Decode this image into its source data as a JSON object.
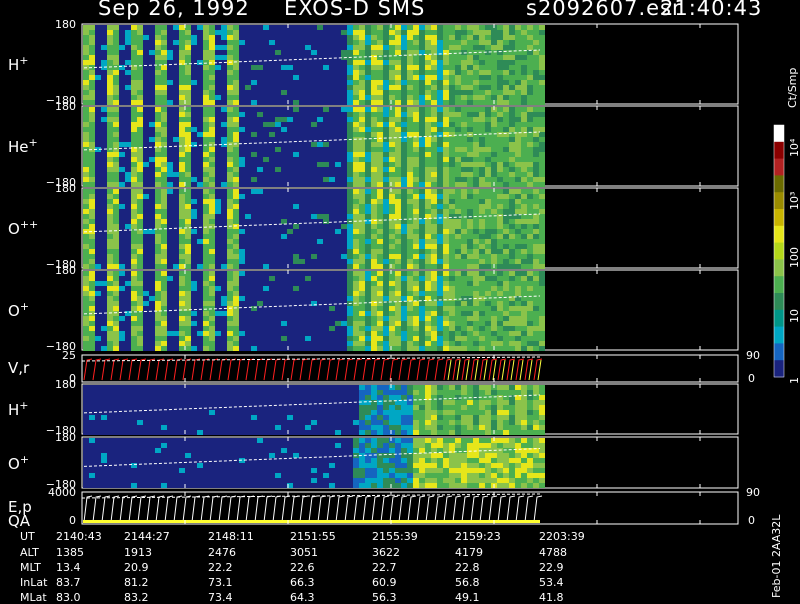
{
  "header": {
    "date": "Sep 26, 1992",
    "instrument": "EXOS-D SMS",
    "file": "s2092607.esr",
    "time": "21:40:43"
  },
  "panels": [
    {
      "label": "H",
      "sup": "+",
      "ymax": "180",
      "ymin": "−180"
    },
    {
      "label": "He",
      "sup": "+",
      "ymax": "180",
      "ymin": "−180"
    },
    {
      "label": "O",
      "sup": "++",
      "ymax": "180",
      "ymin": "−180"
    },
    {
      "label": "O",
      "sup": "+",
      "ymax": "180",
      "ymin": "−180"
    },
    {
      "label": "V,r",
      "sup": "",
      "ymax": "25",
      "ymin": "0",
      "rmax": "90",
      "rmin": "0"
    },
    {
      "label": "H",
      "sup": "+",
      "ymax": "180",
      "ymin": "−180"
    },
    {
      "label": "O",
      "sup": "+",
      "ymax": "180",
      "ymin": "−180"
    },
    {
      "label": "E,p",
      "label2": "QA",
      "sup": "",
      "ymax": "4000",
      "ymin": "0",
      "rmax": "90",
      "rmin": "0"
    }
  ],
  "colorbar": {
    "unit": "Ct/Smp",
    "ticks": [
      "10⁴",
      "10³",
      "100",
      "10",
      "1"
    ]
  },
  "footer_side": "Feb-01 2AA32L",
  "ephemeris": {
    "rows": [
      {
        "name": "UT",
        "values": [
          "2140:43",
          "2144:27",
          "2148:11",
          "2151:55",
          "2155:39",
          "2159:23",
          "2203:39"
        ]
      },
      {
        "name": "ALT",
        "values": [
          "1385",
          "1913",
          "2476",
          "3051",
          "3622",
          "4179",
          "4788"
        ]
      },
      {
        "name": "MLT",
        "values": [
          "13.4",
          "20.9",
          "22.2",
          "22.6",
          "22.7",
          "22.8",
          "22.9"
        ]
      },
      {
        "name": "InLat",
        "values": [
          "83.7",
          "81.2",
          "73.1",
          "66.3",
          "60.9",
          "56.8",
          "53.4"
        ]
      },
      {
        "name": "MLat",
        "values": [
          "83.0",
          "83.2",
          "73.4",
          "64.3",
          "56.3",
          "49.1",
          "41.8"
        ]
      }
    ]
  },
  "chart_data": {
    "type": "heatmap",
    "title": "Sep 26, 1992   EXOS-D SMS",
    "x_time_ticks": [
      "2140:43",
      "2144:27",
      "2148:11",
      "2151:55",
      "2155:39",
      "2159:23",
      "2203:39"
    ],
    "colorbar_scale": "log",
    "colorbar_range": [
      1,
      10000
    ],
    "colorbar_unit": "Ct/Smp",
    "panels": [
      {
        "species": "H+",
        "ylim": [
          -180,
          180
        ]
      },
      {
        "species": "He+",
        "ylim": [
          -180,
          180
        ]
      },
      {
        "species": "O++",
        "ylim": [
          -180,
          180
        ]
      },
      {
        "species": "O+",
        "ylim": [
          -180,
          180
        ]
      },
      {
        "species": "V,r",
        "ylim": [
          0,
          25
        ],
        "right_ylim": [
          0,
          90
        ]
      },
      {
        "species": "H+",
        "ylim": [
          -180,
          180
        ]
      },
      {
        "species": "O+",
        "ylim": [
          -180,
          180
        ]
      },
      {
        "species": "E,p / QA",
        "ylim": [
          0,
          4000
        ],
        "right_ylim": [
          0,
          90
        ]
      }
    ]
  }
}
